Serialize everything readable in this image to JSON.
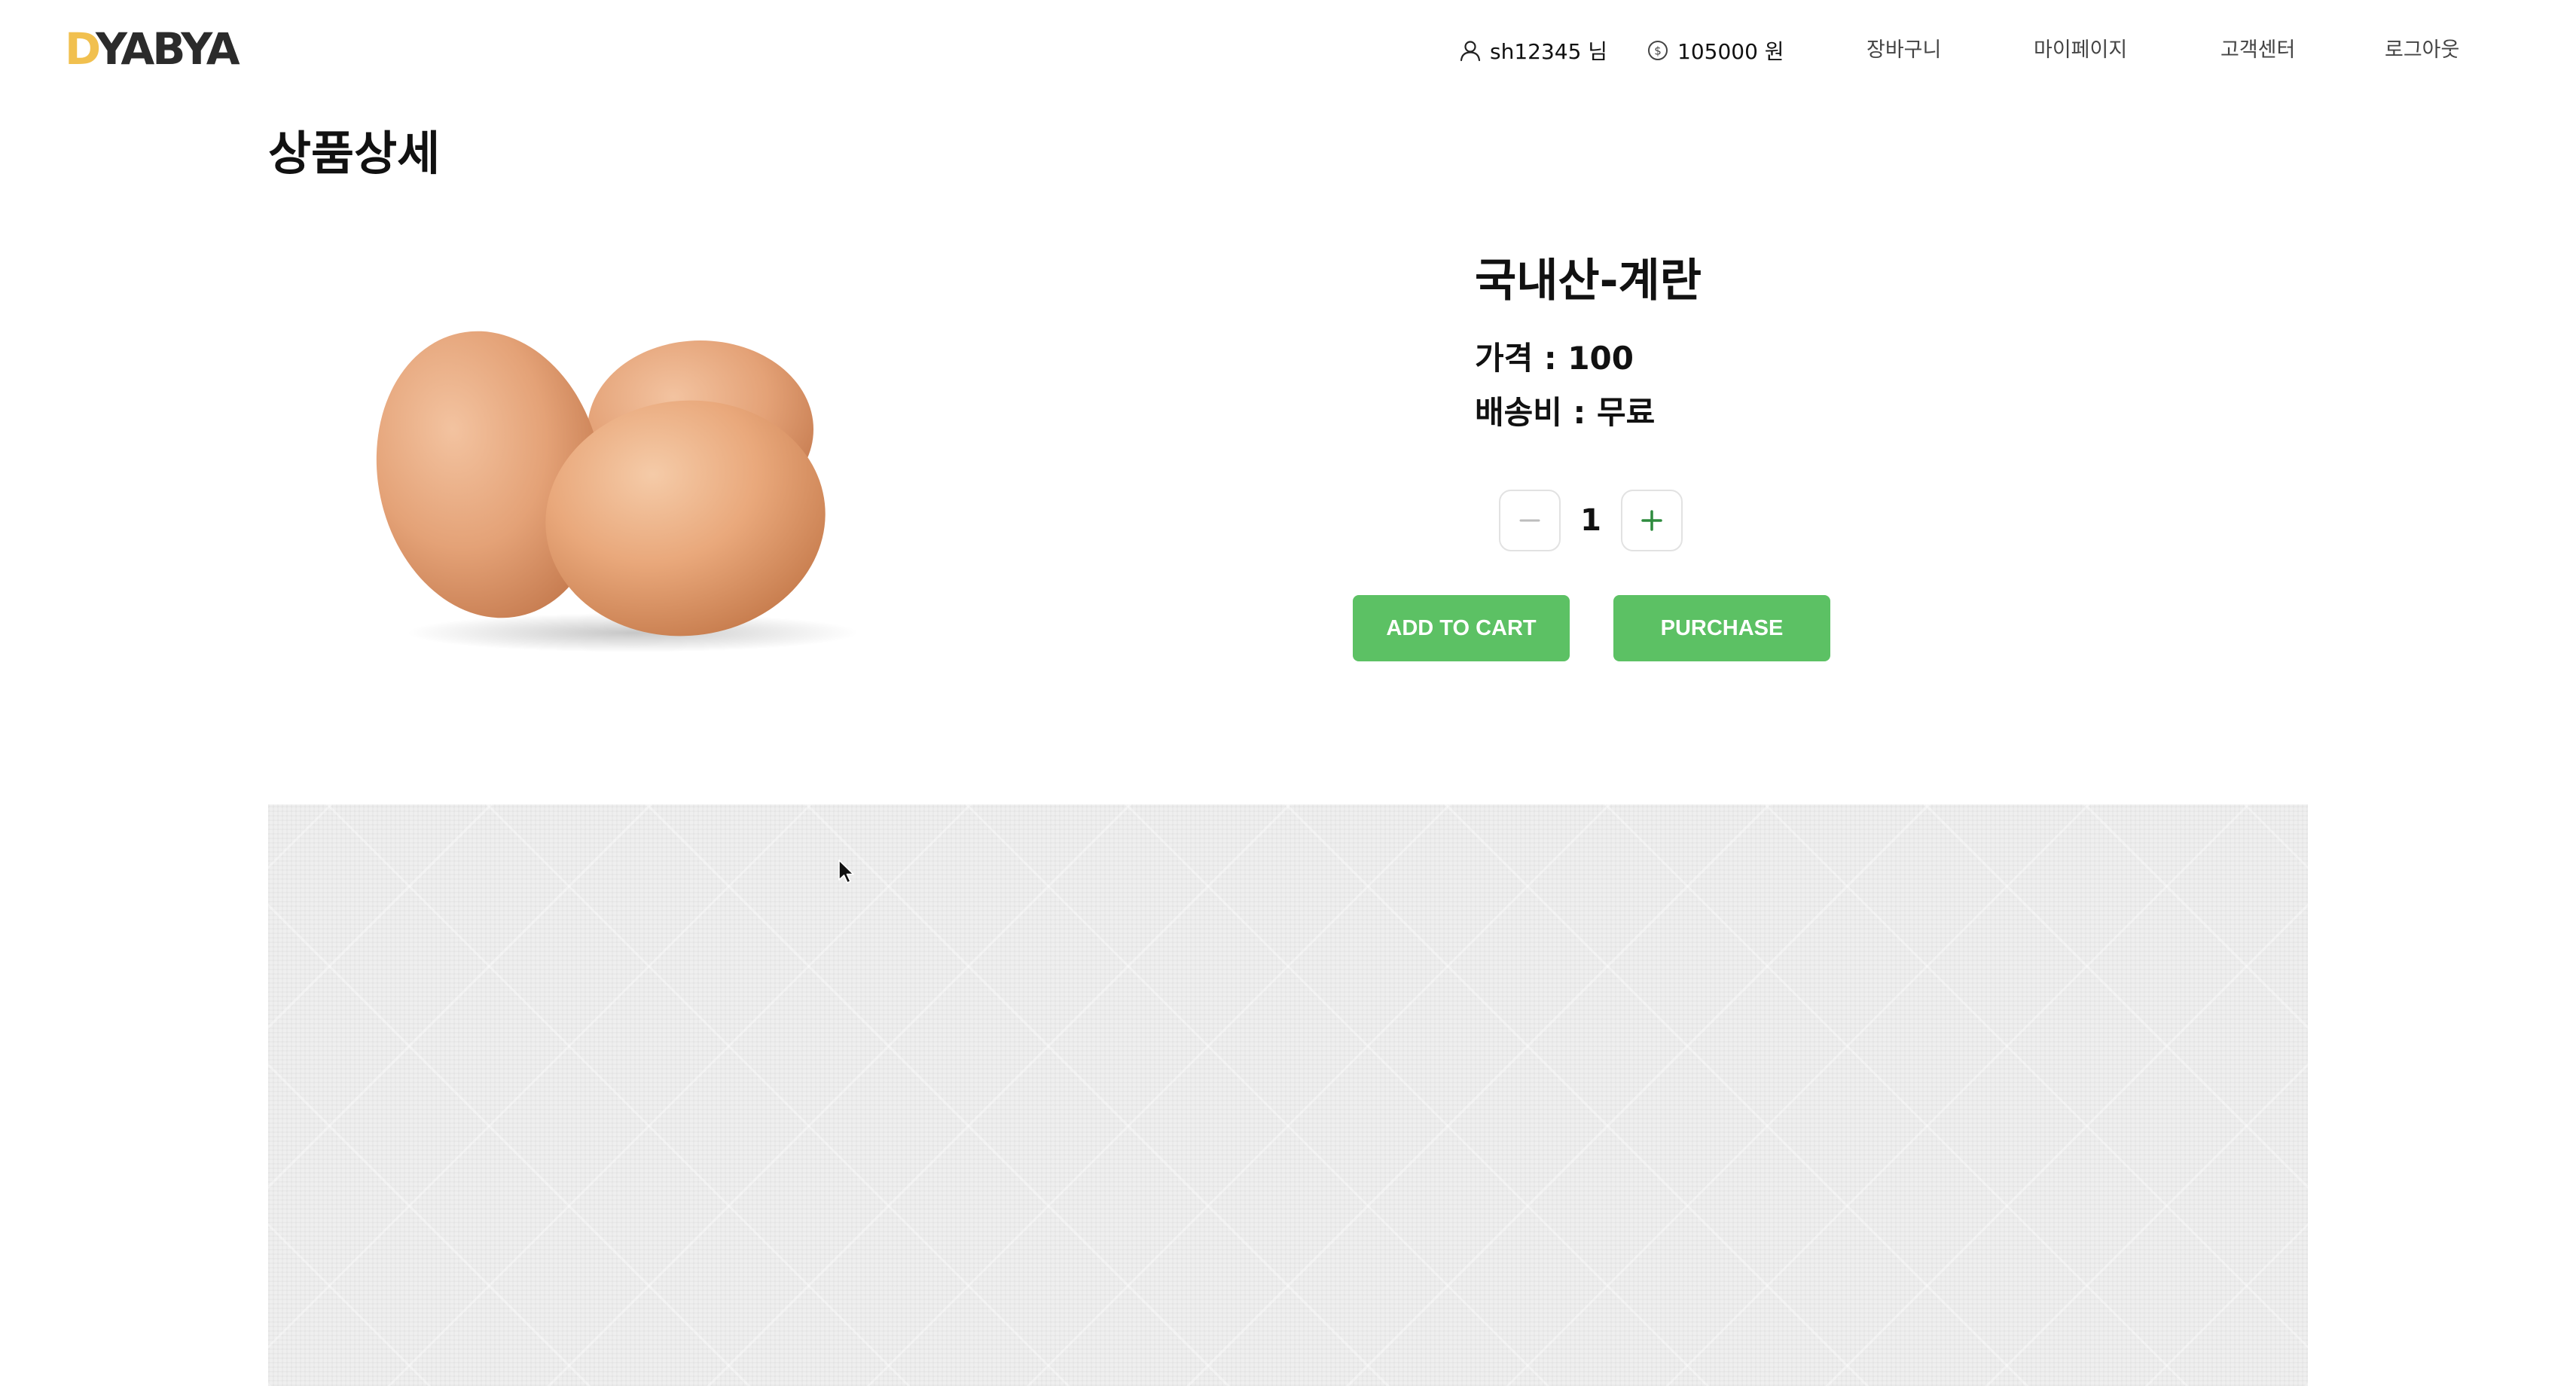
{
  "header": {
    "logo_first": "D",
    "logo_rest": "YABYA",
    "user_name": "sh12345 님",
    "user_icon": "user-icon",
    "coins": "105000 원",
    "coin_icon": "coin-icon",
    "nav": {
      "cart": "장바구니",
      "mypage": "마이페이지",
      "support": "고객센터",
      "logout": "로그아웃"
    }
  },
  "page": {
    "title": "상품상세"
  },
  "product": {
    "name": "국내산-계란",
    "price_line": "가격 : 100",
    "shipping_line": "배송비 : 무료",
    "image_icon": "eggs-image",
    "quantity": "1"
  },
  "actions": {
    "add_to_cart": "ADD TO CART",
    "purchase": "PURCHASE"
  },
  "colors": {
    "brand_accent": "#f1c04f",
    "logo_text": "#2b2b2b",
    "button_green": "#5cc164",
    "plus_green": "#2e8b3e",
    "detail_background": "#efefef"
  }
}
